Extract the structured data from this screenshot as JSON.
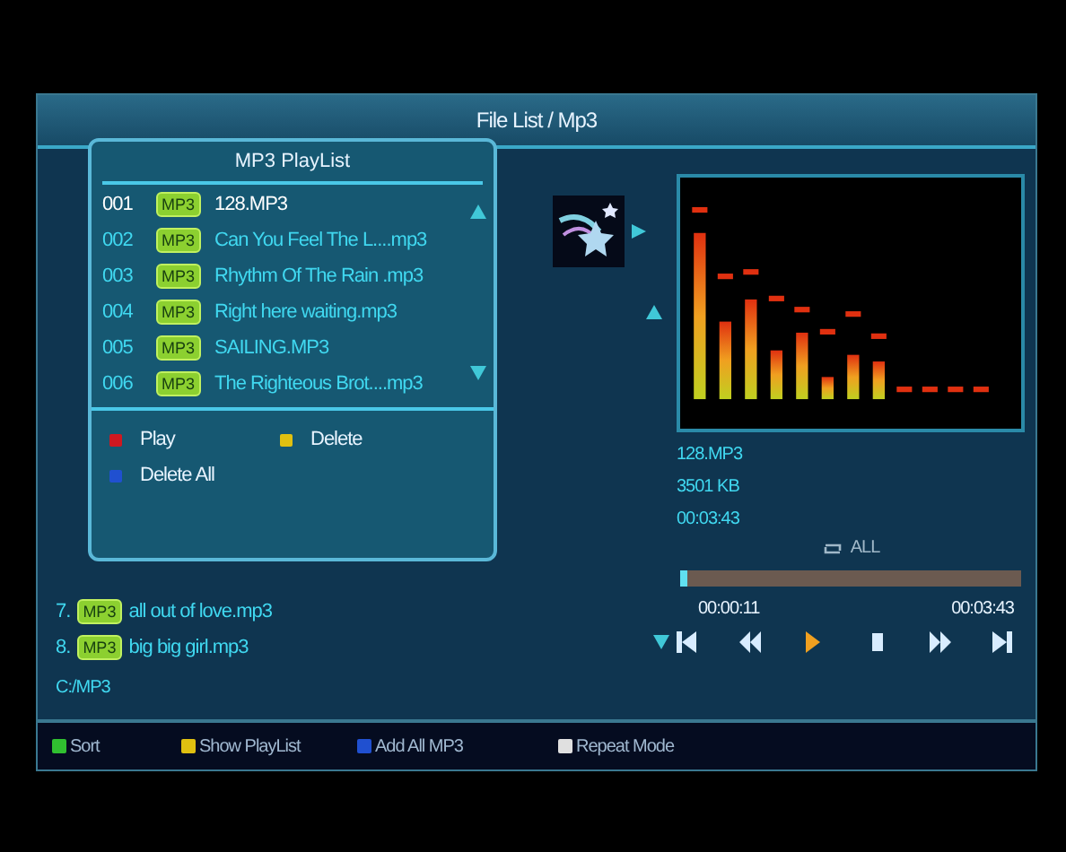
{
  "window": {
    "title": "File List / Mp3"
  },
  "file_list": {
    "items": [
      {
        "index": "7.",
        "badge": "MP3",
        "name": "all out of love.mp3"
      },
      {
        "index": "8.",
        "badge": "MP3",
        "name": "big big girl.mp3"
      }
    ],
    "path": "C:/MP3"
  },
  "playlist": {
    "title": "MP3 PlayList",
    "items": [
      {
        "number": "001",
        "badge": "MP3",
        "name": "128.MP3",
        "selected": true
      },
      {
        "number": "002",
        "badge": "MP3",
        "name": "Can You Feel The L....mp3",
        "selected": false
      },
      {
        "number": "003",
        "badge": "MP3",
        "name": "Rhythm Of The Rain .mp3",
        "selected": false
      },
      {
        "number": "004",
        "badge": "MP3",
        "name": "Right here waiting.mp3",
        "selected": false
      },
      {
        "number": "005",
        "badge": "MP3",
        "name": "SAILING.MP3",
        "selected": false
      },
      {
        "number": "006",
        "badge": "MP3",
        "name": "The Righteous Brot....mp3",
        "selected": false
      }
    ],
    "keys": [
      {
        "label": "Play",
        "color": "#d01820"
      },
      {
        "label": "Delete",
        "color": "#e0c010"
      },
      {
        "label": "Delete All",
        "color": "#2050d0"
      }
    ]
  },
  "player": {
    "file_name": "128.MP3",
    "size": "3501 KB",
    "duration": "00:03:43",
    "repeat": "ALL",
    "progress": {
      "level": 0.02
    },
    "elapsed": "00:00:11",
    "total": "00:03:43",
    "controls": [
      {
        "kind": "first",
        "selected": false
      },
      {
        "kind": "rewind",
        "selected": false
      },
      {
        "kind": "play",
        "selected": true
      },
      {
        "kind": "stop",
        "selected": false
      },
      {
        "kind": "forward",
        "selected": false
      },
      {
        "kind": "last",
        "selected": false
      }
    ]
  },
  "footer": [
    {
      "label": "Sort",
      "color": "#30c030"
    },
    {
      "label": "Show PlayList",
      "color": "#e0c010"
    },
    {
      "label": "Add All MP3",
      "color": "#2050d0"
    },
    {
      "label": "Repeat Mode",
      "color": "#e0e0e0"
    }
  ]
}
